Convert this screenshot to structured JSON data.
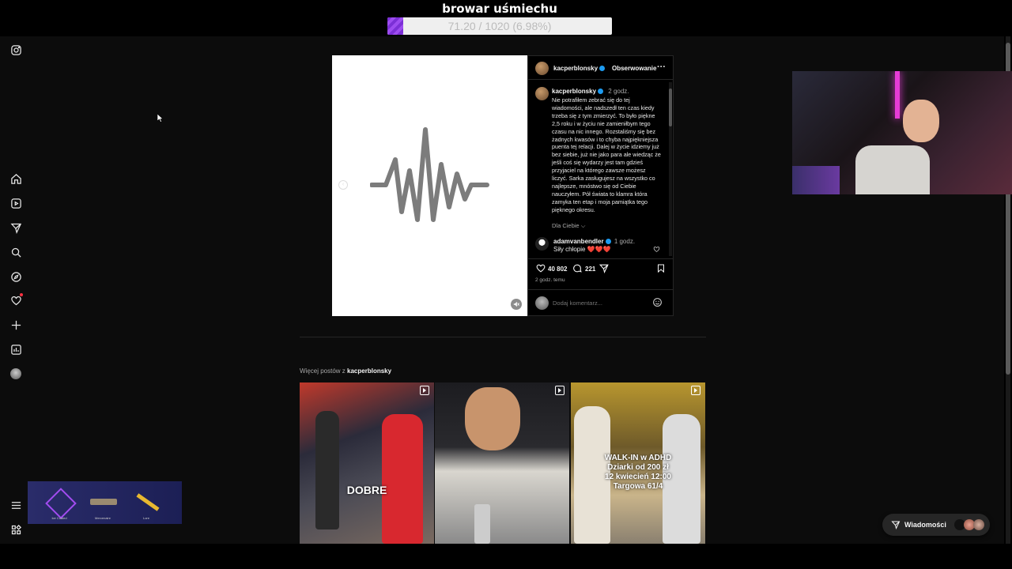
{
  "stream": {
    "goal_title": "browar uśmiechu",
    "goal_text": "71.20 / 1020 (6.98%)",
    "goal_progress_percent": 6.98,
    "goal_fill_color": "#8a3fe6"
  },
  "sidebar": {
    "icons": [
      "instagram-icon",
      "home-icon",
      "reels-icon",
      "messages-icon",
      "search-icon",
      "explore-icon",
      "notifications-icon",
      "create-icon",
      "dashboard-icon",
      "profile-icon",
      "menu-icon",
      "more-apps-icon"
    ]
  },
  "post": {
    "header_username": "kacperblonsky",
    "follow_state": "Obserwowanie",
    "more": "···",
    "caption_username": "kacperblonsky",
    "caption_time": "2 godz.",
    "caption": "Nie potrafiłem zebrać się do tej wiadomości, ale nadszedł ten czas kiedy trzeba się z tym zmierzyć. To było piękne 2,5 roku i w życiu nie zamieniłbym tego czasu na nic innego. Rozstaliśmy się bez żadnych kwasów i to chyba najpiękniejsza puenta tej relacji. Dalej w życie idziemy już bez siebie, już nie jako para ale wiedząc że jeśli coś się wydarzy jest tam gdzieś przyjaciel na którego zawsze możesz liczyć. Sarka zasługujesz na wszystko co najlepsze, mnóstwo się od Ciebie nauczyłem. Pół świata to klamra która zamyka ten etap i moja pamiątka tego pięknego okresu.",
    "for_you": "Dla Ciebie",
    "comment": {
      "username": "adamvanbendler",
      "time": "1 godz.",
      "text": "Siły chłopie ❤️❤️❤️"
    },
    "likes": "40 802",
    "comments_count": "221",
    "posted_ago": "2 godz. temu",
    "comment_placeholder": "Dodaj komentarz..."
  },
  "more_posts": {
    "prefix": "Więcej postów z ",
    "username": "kacperblonsky",
    "thumbs": [
      {
        "overlay": "DOBRE"
      },
      {
        "overlay": ""
      },
      {
        "overlay": "WALK-IN w ADHD\nDziarki od 200 zł\n12 kwiecień 12:00\nTargowa 61/4"
      }
    ]
  },
  "inventory": {
    "items": [
      {
        "label": "Ice Coaled"
      },
      {
        "label": "Mercenaire"
      },
      {
        "label": "Lore"
      }
    ]
  },
  "messages_button": {
    "label": "Wiadomości"
  }
}
